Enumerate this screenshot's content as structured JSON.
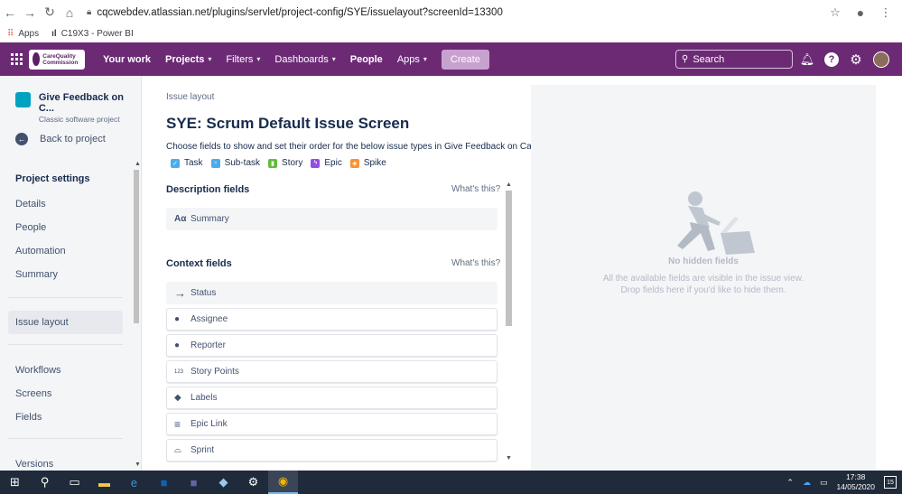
{
  "browser": {
    "url": "cqcwebdev.atlassian.net/plugins/servlet/project-config/SYE/issuelayout?screenId=13300",
    "bookmarks": [
      "Apps",
      "C19X3 - Power BI"
    ]
  },
  "topnav": {
    "logo_text": "CareQuality Commission",
    "items": [
      {
        "label": "Your work",
        "dropdown": false
      },
      {
        "label": "Projects",
        "dropdown": true
      },
      {
        "label": "Filters",
        "dropdown": true
      },
      {
        "label": "Dashboards",
        "dropdown": true
      },
      {
        "label": "People",
        "dropdown": false
      },
      {
        "label": "Apps",
        "dropdown": true
      }
    ],
    "create_label": "Create",
    "search_placeholder": "Search",
    "icons": [
      "notifications-icon",
      "help-icon",
      "settings-icon",
      "avatar"
    ],
    "color": "#6c2a75"
  },
  "sidebar": {
    "project_name": "Give Feedback on C...",
    "project_type": "Classic software project",
    "back_label": "Back to project",
    "section_title": "Project settings",
    "items": [
      "Details",
      "People",
      "Automation",
      "Summary",
      "Issue layout",
      "Workflows",
      "Screens",
      "Fields",
      "Versions"
    ],
    "active_item": "Issue layout"
  },
  "main": {
    "breadcrumb": "Issue layout",
    "title": "SYE: Scrum Default Issue Screen",
    "description": "Choose fields to show and set their order for the below issue types in Give Feedback on Care.",
    "issue_types": [
      {
        "label": "Task",
        "color": "#4bade8",
        "icon": "task-icon"
      },
      {
        "label": "Sub-task",
        "color": "#4bade8",
        "icon": "subtask-icon"
      },
      {
        "label": "Story",
        "color": "#63ba3c",
        "icon": "story-icon"
      },
      {
        "label": "Epic",
        "color": "#904ee2",
        "icon": "epic-icon"
      },
      {
        "label": "Spike",
        "color": "#f79232",
        "icon": "spike-icon"
      }
    ],
    "description_section": {
      "title": "Description fields",
      "help": "What's this?",
      "fields": [
        {
          "label": "Summary",
          "icon": "text-icon",
          "glyph": "Aα"
        }
      ]
    },
    "context_section": {
      "title": "Context fields",
      "help": "What's this?",
      "fields": [
        {
          "label": "Status",
          "icon": "arrow-right-icon",
          "glyph": "→"
        },
        {
          "label": "Assignee",
          "icon": "user-icon",
          "glyph": "●"
        },
        {
          "label": "Reporter",
          "icon": "user-icon",
          "glyph": "●"
        },
        {
          "label": "Story Points",
          "icon": "number-icon",
          "glyph": "123"
        },
        {
          "label": "Labels",
          "icon": "label-icon",
          "glyph": "◆"
        },
        {
          "label": "Epic Link",
          "icon": "list-icon",
          "glyph": "≡"
        },
        {
          "label": "Sprint",
          "icon": "sprint-icon",
          "glyph": "⌓"
        }
      ]
    }
  },
  "hidden_panel": {
    "title": "No hidden fields",
    "line1": "All the available fields are visible in the issue view.",
    "line2": "Drop fields here if you'd like to hide them."
  },
  "taskbar": {
    "time": "17:38",
    "date": "14/05/2020",
    "notifications": "15"
  }
}
